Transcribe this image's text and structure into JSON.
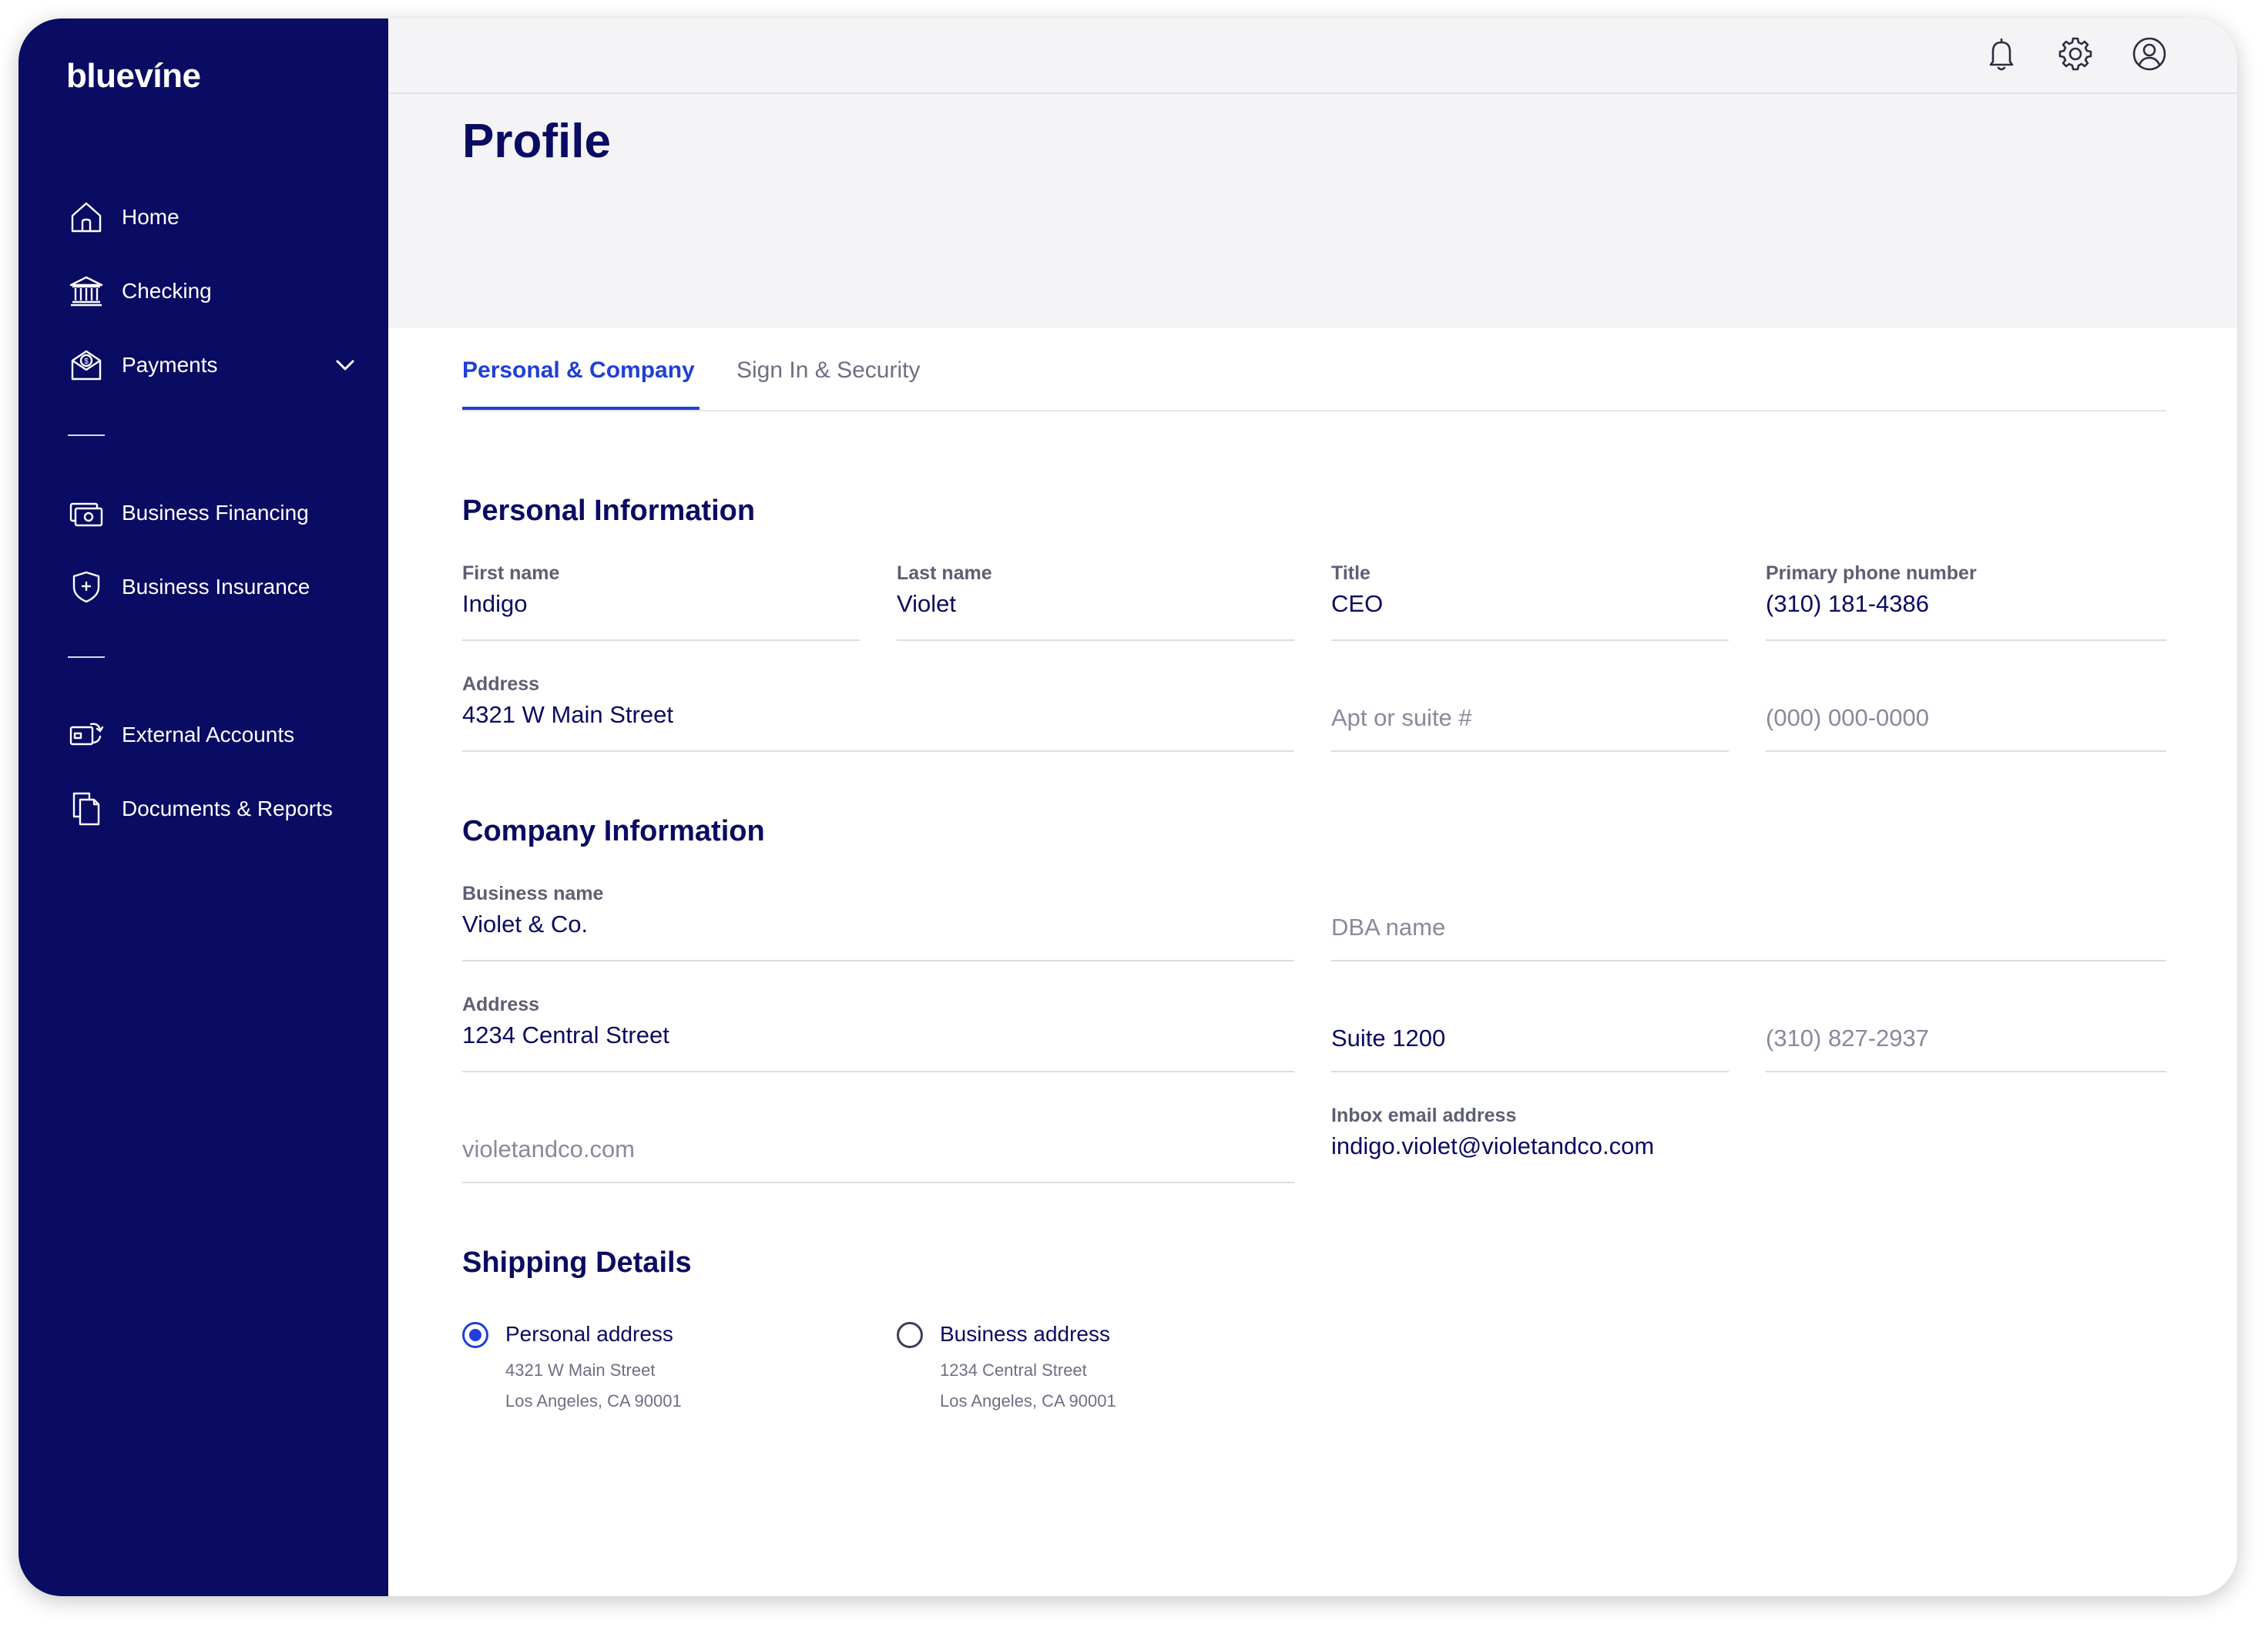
{
  "brand": {
    "logo_text": "bluevíne"
  },
  "sidebar": {
    "items": [
      {
        "label": "Home",
        "icon": "home-icon"
      },
      {
        "label": "Checking",
        "icon": "bank-icon"
      },
      {
        "label": "Payments",
        "icon": "payments-icon",
        "expandable": true
      },
      {
        "label": "Business Financing",
        "icon": "financing-icon"
      },
      {
        "label": "Business Insurance",
        "icon": "shield-icon"
      },
      {
        "label": "External Accounts",
        "icon": "external-accounts-icon"
      },
      {
        "label": "Documents & Reports",
        "icon": "documents-icon"
      }
    ]
  },
  "topbar": {
    "icons": [
      "bell-icon",
      "gear-icon",
      "user-icon"
    ]
  },
  "page": {
    "title": "Profile"
  },
  "tabs": [
    {
      "label": "Personal & Company",
      "active": true
    },
    {
      "label": "Sign In & Security",
      "active": false
    }
  ],
  "personal": {
    "heading": "Personal Information",
    "first_name": {
      "label": "First name",
      "value": "Indigo"
    },
    "last_name": {
      "label": "Last name",
      "value": "Violet"
    },
    "title": {
      "label": "Title",
      "value": "CEO"
    },
    "phone": {
      "label": "Primary phone number",
      "value": "(310) 181-4386"
    },
    "address": {
      "label": "Address",
      "value": "4321 W Main Street"
    },
    "apt": {
      "placeholder": "Apt or suite #"
    },
    "phone2": {
      "placeholder": "(000) 000-0000"
    }
  },
  "company": {
    "heading": "Company Information",
    "business_name": {
      "label": "Business name",
      "value": "Violet & Co."
    },
    "dba": {
      "placeholder": "DBA name"
    },
    "address": {
      "label": "Address",
      "value": "1234 Central Street"
    },
    "suite": {
      "value": "Suite 1200"
    },
    "phone": {
      "value": "(310) 827-2937"
    },
    "website": {
      "value": "violetandco.com"
    },
    "inbox_email": {
      "label": "Inbox email address",
      "value": "indigo.violet@violetandco.com"
    }
  },
  "shipping": {
    "heading": "Shipping Details",
    "options": [
      {
        "label": "Personal address",
        "line1": "4321 W Main Street",
        "line2": "Los Angeles, CA 90001",
        "selected": true
      },
      {
        "label": "Business address",
        "line1": "1234 Central Street",
        "line2": "Los Angeles, CA 90001",
        "selected": false
      }
    ]
  },
  "colors": {
    "sidebar_bg": "#0a0b62",
    "accent": "#1f3fd6",
    "heading": "#0a0b62",
    "page_bg": "#f4f4f7"
  }
}
